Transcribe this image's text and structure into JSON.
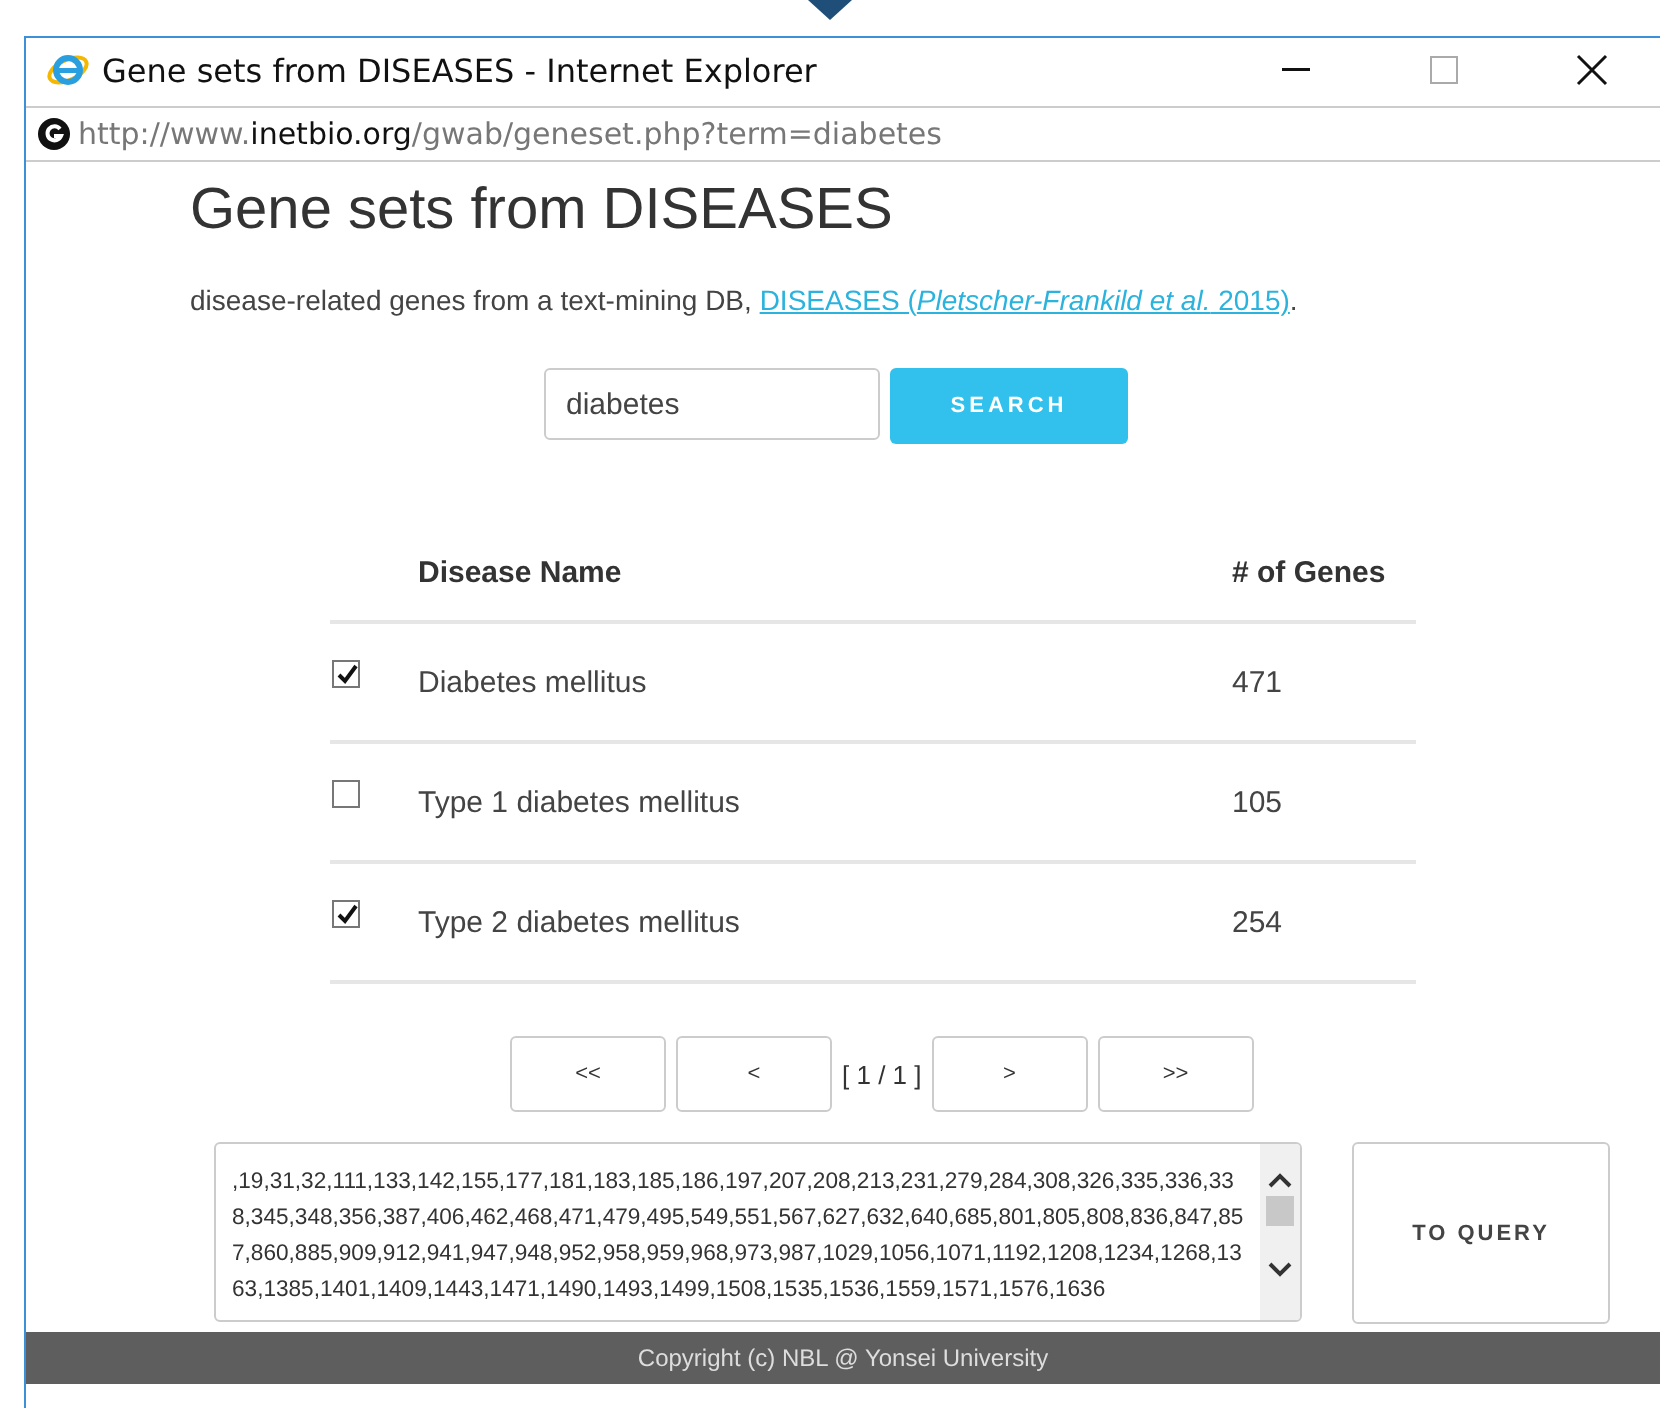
{
  "window": {
    "title": "Gene sets from DISEASES - Internet Explorer",
    "address_prefix": "http://www.",
    "address_domain": "inetbio.org",
    "address_path": "/gwab/geneset.php?term=diabetes"
  },
  "page": {
    "heading": "Gene sets from DISEASES",
    "description": "disease-related genes from a text-mining DB,",
    "description_link": "DISEASES (*Pletscher-Frankild et al.* 2015)",
    "description_end": "."
  },
  "search": {
    "value": "diabetes",
    "button": "SEARCH"
  },
  "table": {
    "columns": [
      "Disease Name",
      "# of Genes"
    ],
    "rows": [
      {
        "name": "Diabetes mellitus",
        "genes": "471",
        "checked": true
      },
      {
        "name": "Type 1 diabetes mellitus",
        "genes": "105",
        "checked": false
      },
      {
        "name": "Type 2 diabetes mellitus",
        "genes": "254",
        "checked": true
      }
    ]
  },
  "pagination": {
    "first": "<<",
    "prev": "<",
    "status": "[ 1 / 1 ]",
    "next": ">",
    "last": ">>"
  },
  "gene_ids": {
    "value": ",19,31,32,111,133,142,155,177,181,183,185,186,197,207,208,213,231,279,284,308,326,335,336,338,345,348,356,387,406,462,468,471,479,495,549,551,567,627,632,640,685,801,805,808,836,847,857,860,885,909,912,941,947,948,952,958,959,968,973,987,1029,1056,1071,1192,1208,1234,1268,1363,1385,1401,1409,1443,1471,1490,1493,1499,1508,1535,1536,1559,1571,1576,1636"
  },
  "query_button": "TO QUERY",
  "footer": "Copyright (c) NBL @ Yonsei University"
}
